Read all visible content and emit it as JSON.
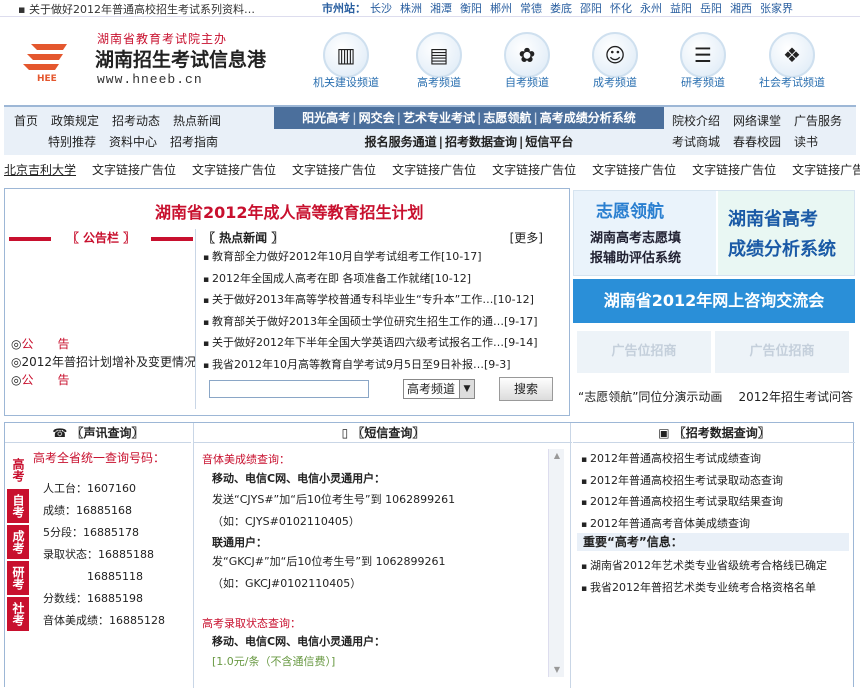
{
  "topbar": {
    "news": "关于做好2012年普通高校招生考试系列资料…",
    "cities_label": "市州站：",
    "cities": [
      "长沙",
      "株洲",
      "湘潭",
      "衡阳",
      "郴州",
      "常德",
      "娄底",
      "邵阳",
      "怀化",
      "永州",
      "益阳",
      "岳阳",
      "湘西",
      "张家界"
    ]
  },
  "logo": {
    "tagline": "湖南省教育考试院主办",
    "name": "湖南招生考试信息港",
    "url": "www.hneeb.cn",
    "mark": "HEE"
  },
  "channels": [
    {
      "label": "机关建设频道",
      "icon": "chart-icon"
    },
    {
      "label": "高考频道",
      "icon": "book-icon"
    },
    {
      "label": "自考频道",
      "icon": "flower-icon"
    },
    {
      "label": "成考频道",
      "icon": "people-icon"
    },
    {
      "label": "研考频道",
      "icon": "books-icon"
    },
    {
      "label": "社会考试频道",
      "icon": "gift-icon"
    }
  ],
  "nav": {
    "left_row1": [
      "首页",
      "政策规定",
      "招考动态",
      "热点新闻"
    ],
    "left_row2": [
      "特别推荐",
      "资料中心",
      "招考指南"
    ],
    "mid_row1": [
      "阳光高考",
      "网交会",
      "艺术专业考试",
      "志愿领航",
      "高考成绩分析系统"
    ],
    "mid_row2": [
      "报名服务通道",
      "招考数据查询",
      "短信平台"
    ],
    "right_row1": [
      "院校介绍",
      "网络课堂",
      "广告服务"
    ],
    "right_row2": [
      "考试商城",
      "春春校园",
      "读书"
    ]
  },
  "ad_links": [
    "北京吉利大学",
    "文字链接广告位",
    "文字链接广告位",
    "文字链接广告位",
    "文字链接广告位",
    "文字链接广告位",
    "文字链接广告位",
    "文字链接广告位",
    "文字链接广告位"
  ],
  "main": {
    "title": "湖南省2012年成人高等教育招生计划",
    "notice_title": "〖 公告栏 〗",
    "notices": [
      {
        "mark": "◎",
        "text": "公　　告",
        "red": true
      },
      {
        "mark": "◎",
        "text": "2012年普招计划增补及变更情况",
        "red": false
      },
      {
        "mark": "◎",
        "text": "公　　告",
        "red": true
      }
    ],
    "hot_title": "〖 热点新闻 〗",
    "hot_more": "[更多]",
    "hot_news": [
      "教育部全力做好2012年10月自学考试组考工作[10-17]",
      "2012年全国成人高考在即 各项准备工作就绪[10-12]",
      "关于做好2013年高等学校普通专科毕业生“专升本”工作…[10-12]",
      "教育部关于做好2013年全国硕士学位研究生招生工作的通…[9-17]",
      "关于做好2012年下半年全国大学英语四六级考试报名工作…[9-14]",
      "我省2012年10月高等教育自学考试9月5日至9日补报…[9-3]"
    ],
    "search_select": "高考频道",
    "search_button": "搜索"
  },
  "banners": {
    "b1_left_title": "志愿领航",
    "b1_left_text": [
      "湖南高考志愿填",
      "报辅助评估系统"
    ],
    "b1_right": [
      "湖南省高考",
      "成绩分析系统"
    ],
    "b2": "湖南省2012年网上咨询交流会",
    "ad1": "广告位招商",
    "ad2": "广告位招商",
    "bottom_links": [
      "“志愿领航”同位分演示动画",
      "2012年招生考试问答"
    ]
  },
  "lower": {
    "col1_title": "〖声讯查询〗",
    "col1_sub": "高考全省统一查询号码：",
    "tabs": [
      "高考",
      "自考",
      "成考",
      "研考",
      "社考"
    ],
    "col1_lines": [
      "人工台：1607160",
      "成绩：16885168",
      "5分段：16885178",
      "录取状态：16885188",
      "　　　　16885118",
      "分数线：16885198",
      "音体美成绩：16885128"
    ],
    "col2_title": "〖短信查询〗",
    "col2_lines": [
      {
        "t": "音体美成绩查询：",
        "k": "red"
      },
      {
        "t": "移动、电信C网、电信小灵通用户：",
        "k": "b"
      },
      {
        "t": "发送“CJYS#”加“后10位考生号”到 1062899261",
        "k": "n"
      },
      {
        "t": "（如：CJYS#0102110405）",
        "k": "n"
      },
      {
        "t": "联通用户：",
        "k": "b"
      },
      {
        "t": "发“GKCJ#”加“后10位考生号”到 1062899261",
        "k": "n"
      },
      {
        "t": "（如：GKCJ#0102110405）",
        "k": "n"
      },
      {
        "t": "高考录取状态查询：",
        "k": "red"
      },
      {
        "t": "移动、电信C网、电信小灵通用户：",
        "k": "b"
      },
      {
        "t": "[1.0元/条（不含通信费）]",
        "k": "g"
      }
    ],
    "col3_title": "〖招考数据查询〗",
    "col3_items": [
      "2012年普通高校招生考试成绩查询",
      "2012年普通高校招生考试录取动态查询",
      "2012年普通高校招生考试录取结果查询",
      "2012年普通高考音体美成绩查询"
    ],
    "col3_important": "重要“高考”信息：",
    "col3_items2": [
      "湖南省2012年艺术类专业省级统考合格线已确定",
      "我省2012年普招艺术类专业统考合格资格名单"
    ]
  },
  "colors": {
    "brand_red": "#c8102e",
    "nav_blue": "#4b6f9c",
    "link_blue": "#2a6fb0"
  }
}
